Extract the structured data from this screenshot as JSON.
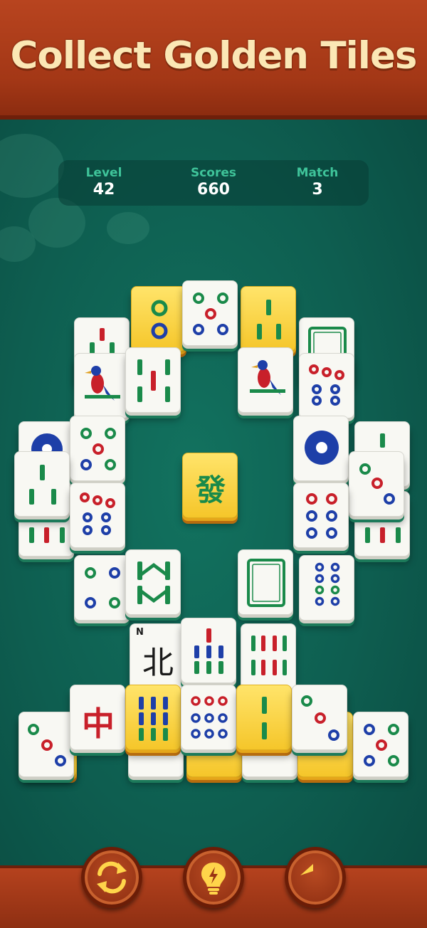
{
  "banner": {
    "title": "Collect Golden Tiles"
  },
  "stats": {
    "level_label": "Level",
    "level_value": "42",
    "scores_label": "Scores",
    "scores_value": "660",
    "match_label": "Match",
    "match_value": "3"
  },
  "tiles": {
    "north_wind_letter": "N",
    "north_wind_char": "北",
    "red_dragon_char": "中",
    "green_dragon_char": "發"
  },
  "buttons": {
    "shuffle_icon": "shuffle-icon",
    "hint_icon": "lightbulb-icon",
    "undo_icon": "undo-arrow-icon"
  },
  "colors": {
    "banner": "#a33716",
    "board": "#0e5e50",
    "title_text": "#fbe7b5",
    "stat_label": "#3fc49a",
    "tile_face": "#f8f8f3",
    "golden_tile": "#f5c62a"
  }
}
